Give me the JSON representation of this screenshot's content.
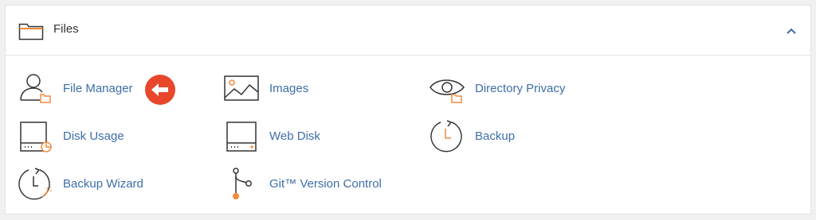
{
  "section": {
    "title": "Files",
    "collapse_icon": "chevron-up-icon"
  },
  "items": [
    {
      "label": "File Manager",
      "icon": "file-manager-icon"
    },
    {
      "label": "Images",
      "icon": "images-icon"
    },
    {
      "label": "Directory Privacy",
      "icon": "directory-privacy-icon"
    },
    {
      "label": "Disk Usage",
      "icon": "disk-usage-icon"
    },
    {
      "label": "Web Disk",
      "icon": "web-disk-icon"
    },
    {
      "label": "Backup",
      "icon": "backup-icon"
    },
    {
      "label": "Backup Wizard",
      "icon": "backup-wizard-icon"
    },
    {
      "label": "Git™ Version Control",
      "icon": "git-version-control-icon"
    }
  ],
  "annotation": {
    "icon": "left-arrow-icon"
  },
  "colors": {
    "link": "#3d6ea8",
    "icon_stroke": "#333333",
    "accent": "#f28a3c",
    "arrow_badge": "#e8472c"
  }
}
